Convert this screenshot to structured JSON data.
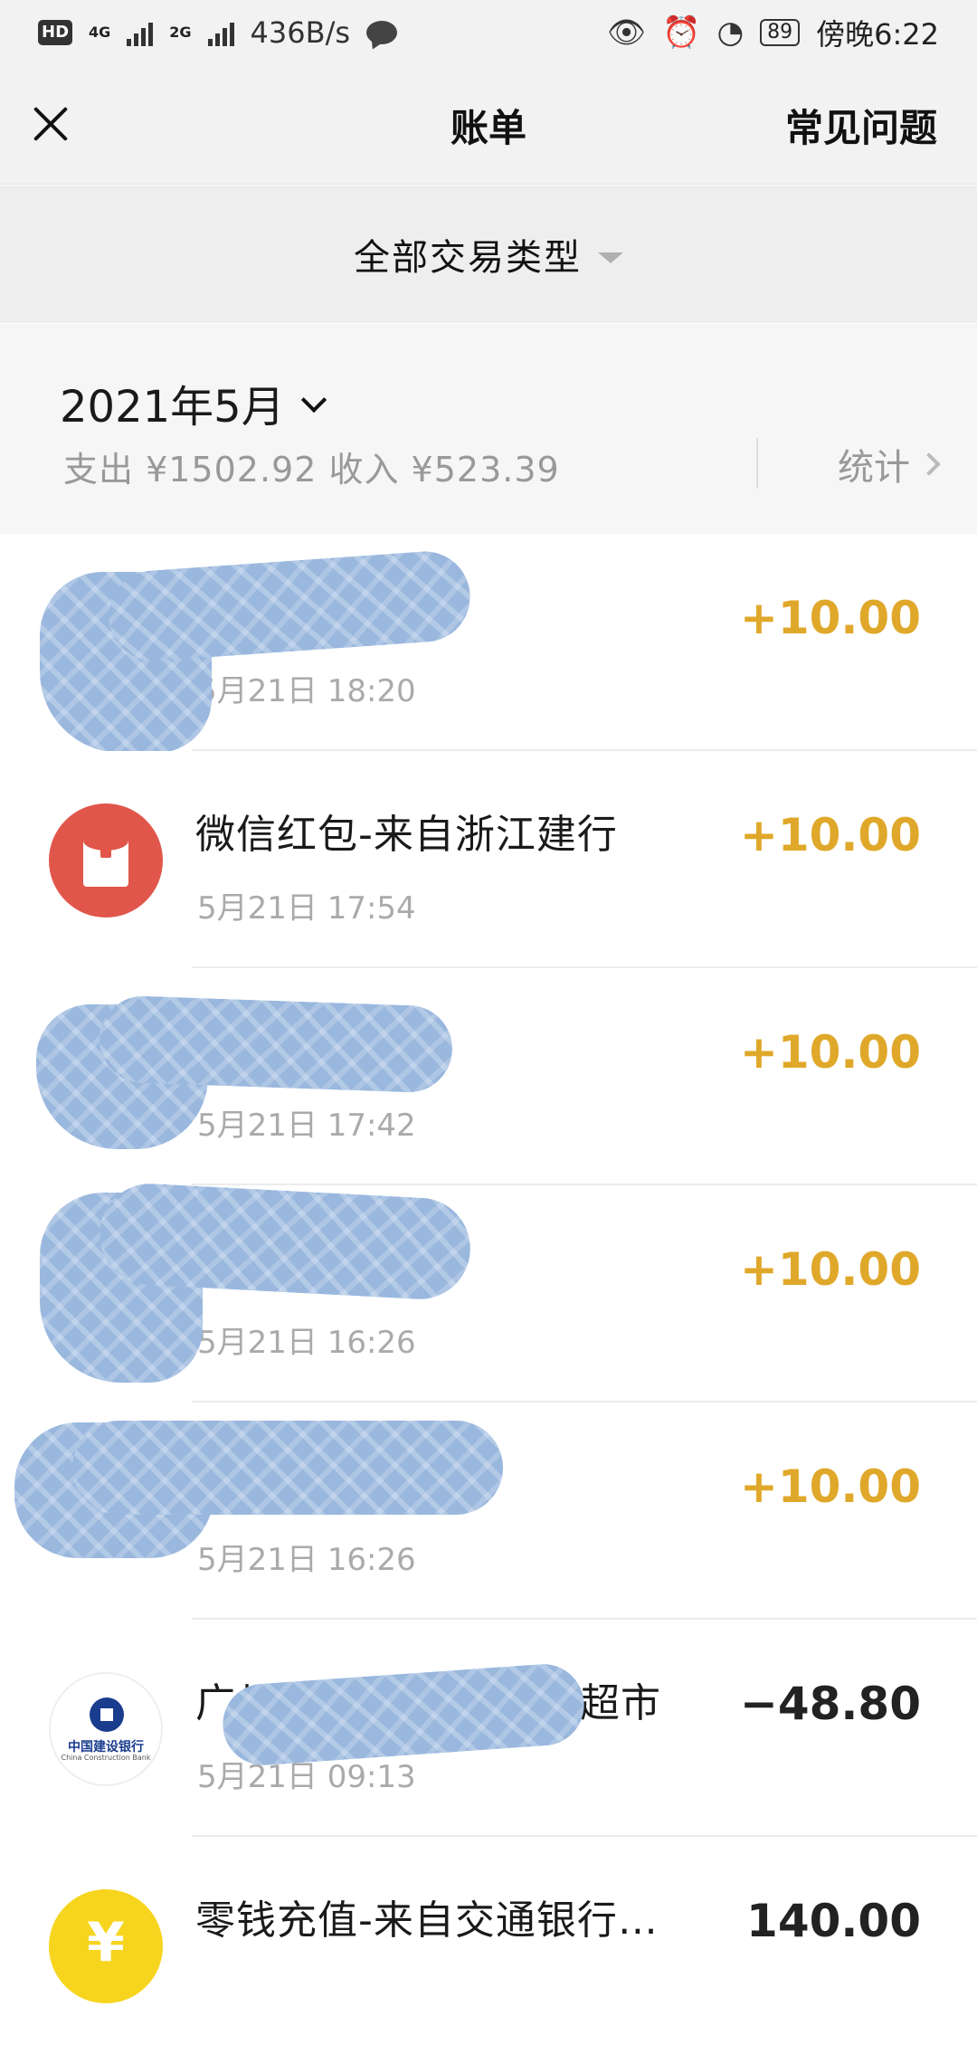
{
  "status_bar": {
    "hd": "HD",
    "net1": "4G",
    "net2": "2G",
    "speed": "436B/s",
    "battery": "89",
    "time": "傍晚6:22"
  },
  "nav": {
    "title": "账单",
    "faq": "常见问题"
  },
  "filter": {
    "label": "全部交易类型"
  },
  "summary": {
    "month": "2021年5月",
    "totals": "支出 ¥1502.92 收入 ¥523.39",
    "stats": "统计"
  },
  "transactions": [
    {
      "title": "",
      "time": "5月21日 18:20",
      "amount": "+10.00",
      "icon": "redacted-icon"
    },
    {
      "title": "微信红包-来自浙江建行",
      "time": "5月21日 17:54",
      "amount": "+10.00",
      "icon": "red-packet-icon"
    },
    {
      "title": "",
      "time": "5月21日 17:42",
      "amount": "+10.00",
      "icon": "redacted-icon"
    },
    {
      "title": "",
      "time": "5月21日 16:26",
      "amount": "+10.00",
      "icon": "redacted-icon"
    },
    {
      "title": "",
      "time": "5月21日 16:26",
      "amount": "+10.00",
      "icon": "redacted-icon"
    },
    {
      "title": "广州市",
      "title_end": "超市",
      "time": "5月21日 09:13",
      "amount": "−48.80",
      "icon": "ccb-bank-icon",
      "icon_text_cn": "中国建设银行",
      "icon_text_en": "China Construction Bank"
    },
    {
      "title": "零钱充值-来自交通银行…",
      "time": "",
      "amount": "140.00",
      "icon": "coin-icon",
      "icon_glyph": "¥"
    }
  ],
  "colors": {
    "income": "#e0a82a",
    "expense": "#222222",
    "redpacket": "#e1564a",
    "coin": "#f7d51e",
    "redaction": "#9ab8de"
  }
}
